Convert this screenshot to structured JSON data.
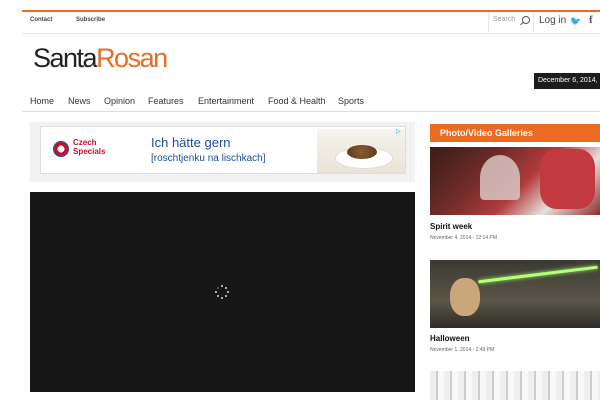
{
  "topbar": {
    "contact": "Contact",
    "subscribe": "Subscribe",
    "search_placeholder": "Search",
    "login": "Log in"
  },
  "logo": {
    "part1": "Santa",
    "part2": "Rosan"
  },
  "date": "December 6, 2014,",
  "nav": [
    "Home",
    "News",
    "Opinion",
    "Features",
    "Entertainment",
    "Food & Health",
    "Sports"
  ],
  "ad": {
    "brand_line1": "Czech",
    "brand_line2": "Specials",
    "headline": "Ich hätte gern",
    "subline": "[roschtjenku na lischkach]"
  },
  "sidebar": {
    "heading": "Photo/Video Galleries",
    "items": [
      {
        "title": "Spirit week",
        "date": "November 4, 2014 - 12:14 PM"
      },
      {
        "title": "Halloween",
        "date": "November 1, 2014 - 2:49 PM"
      }
    ]
  },
  "colors": {
    "accent": "#ec6b23",
    "dark": "#161616"
  },
  "icons": [
    "search-icon",
    "twitter-icon",
    "facebook-icon",
    "spinner-icon",
    "adchoices-icon"
  ]
}
